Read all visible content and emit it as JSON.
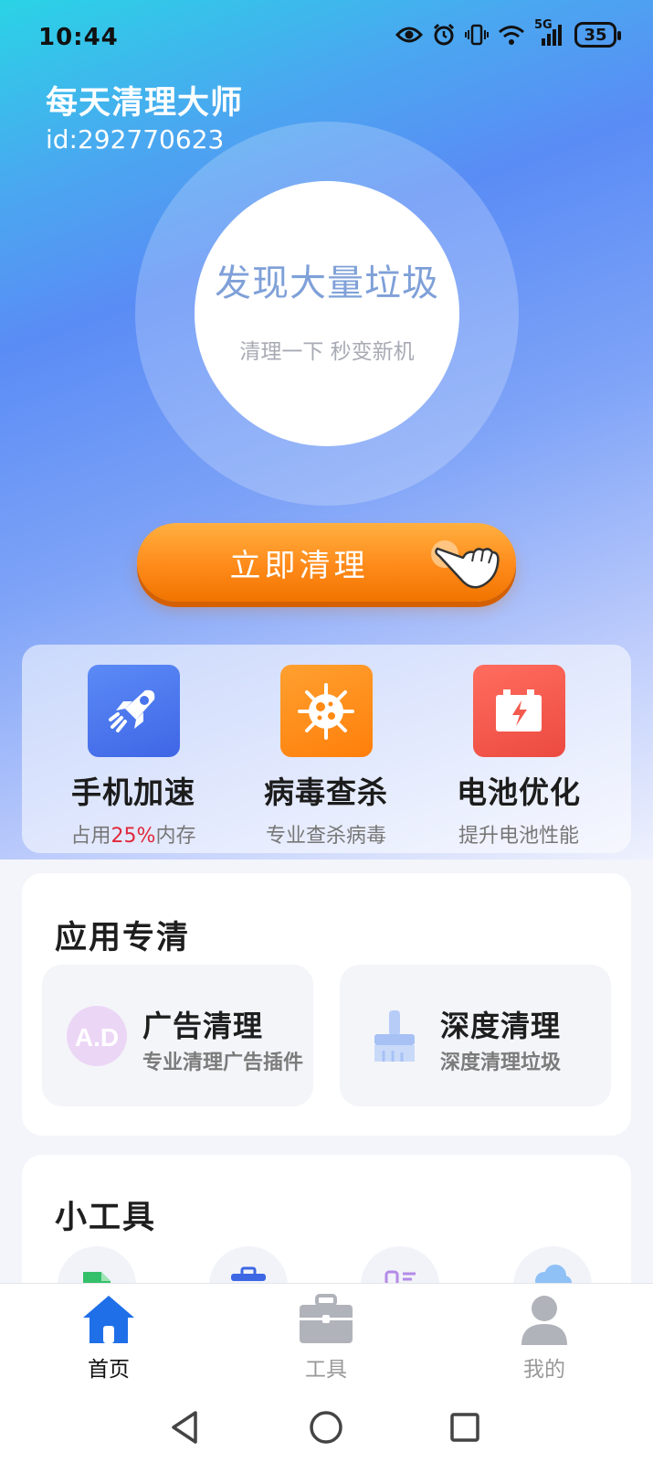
{
  "status_bar": {
    "time": "10:44",
    "network": "5G",
    "battery": "35",
    "icons": [
      "eye-icon",
      "alarm-icon",
      "vibrate-icon",
      "wifi-icon",
      "signal-icon",
      "battery-icon"
    ]
  },
  "header": {
    "app_title": "每天清理大师",
    "user_id": "id:292770623"
  },
  "scan": {
    "headline": "发现大量垃圾",
    "subline": "清理一下 秒变新机"
  },
  "clean_button": {
    "label": "立即清理",
    "icon": "pointing-hand-icon"
  },
  "quick_actions": [
    {
      "title": "手机加速",
      "desc_prefix": "占用",
      "desc_highlight": "25%",
      "desc_suffix": "内存",
      "icon": "rocket-icon",
      "color": "#4f7cf2"
    },
    {
      "title": "病毒查杀",
      "desc": "专业查杀病毒",
      "icon": "virus-icon",
      "color": "#ff8a14"
    },
    {
      "title": "电池优化",
      "desc": "提升电池性能",
      "icon": "battery-charge-icon",
      "color": "#f25a4e"
    }
  ],
  "app_clean": {
    "title": "应用专清",
    "items": [
      {
        "title": "广告清理",
        "desc": "专业清理广告插件",
        "icon": "ad-icon"
      },
      {
        "title": "深度清理",
        "desc": "深度清理垃圾",
        "icon": "brush-icon"
      }
    ]
  },
  "tools": {
    "title": "小工具",
    "icons": [
      "file-icon",
      "toolbox-icon",
      "list-icon",
      "cloud-icon"
    ]
  },
  "bottom_nav": {
    "items": [
      {
        "label": "首页",
        "icon": "home-icon",
        "active": true
      },
      {
        "label": "工具",
        "icon": "briefcase-icon",
        "active": false
      },
      {
        "label": "我的",
        "icon": "person-icon",
        "active": false
      }
    ]
  },
  "colors": {
    "accent_blue": "#4f7cf2",
    "accent_orange": "#ff8a14",
    "accent_red": "#f25a4e",
    "highlight_red": "#e0283a"
  }
}
